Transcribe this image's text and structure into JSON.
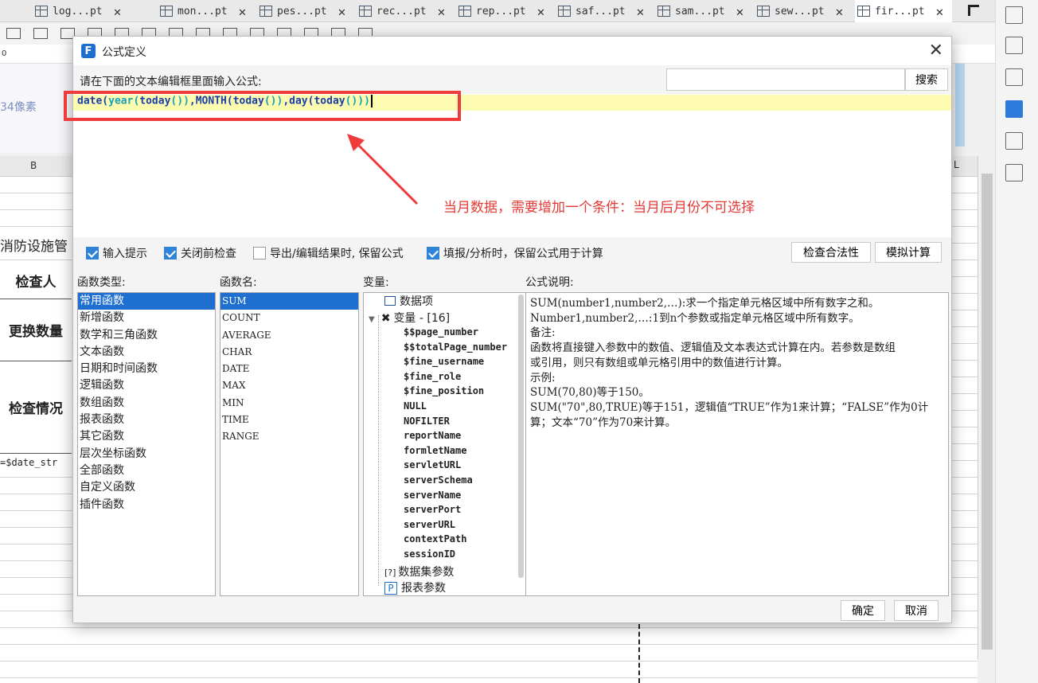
{
  "tabs": [
    {
      "label": "log...pt"
    },
    {
      "label": "mon...pt"
    },
    {
      "label": "pes...pt"
    },
    {
      "label": "rec...pt"
    },
    {
      "label": "rep...pt"
    },
    {
      "label": "saf...pt"
    },
    {
      "label": "sam...pt"
    },
    {
      "label": "sew...pt"
    },
    {
      "label": "fir...pt",
      "active": true
    }
  ],
  "ruler": {
    "zero": "0"
  },
  "left_prop": {
    "px_text": "34像素"
  },
  "sheet": {
    "col_b": "B",
    "col_l": "L",
    "b1": "消防设施管",
    "rows": [
      {
        "label": "检查人"
      },
      {
        "label": "更换数量"
      },
      {
        "label": "检查情况"
      }
    ],
    "date_cell": "=$date_str"
  },
  "dialog": {
    "title": "公式定义",
    "prompt": "请在下面的文本编辑框里面输入公式:",
    "search_button": "搜索",
    "search_value": "",
    "formula": {
      "p1": "date(",
      "p2": "year(",
      "p3": "today",
      "p4": "())",
      "p5": ",MONTH(",
      "p6": "today",
      "p7": "())",
      "p8": ",day(",
      "p9": "today",
      "p10": "()))"
    },
    "annotation": "当月数据，需要增加一个条件：当月后月份不可选择",
    "checkboxes": [
      {
        "label": "输入提示",
        "checked": true
      },
      {
        "label": "关闭前检查",
        "checked": true
      },
      {
        "label": "导出/编辑结果时, 保留公式",
        "checked": false
      },
      {
        "label": "填报/分析时，保留公式用于计算",
        "checked": true
      }
    ],
    "check_validity_button": "检查合法性",
    "simulate_button": "模拟计算",
    "headers": {
      "func_type": "函数类型:",
      "func_name": "函数名:",
      "variables": "变量:",
      "description": "公式说明:"
    },
    "func_types": [
      "常用函数",
      "新增函数",
      "数学和三角函数",
      "文本函数",
      "日期和时间函数",
      "逻辑函数",
      "数组函数",
      "报表函数",
      "其它函数",
      "层次坐标函数",
      "全部函数",
      "自定义函数",
      "插件函数"
    ],
    "func_names": [
      "SUM",
      "COUNT",
      "AVERAGE",
      "CHAR",
      "DATE",
      "MAX",
      "MIN",
      "TIME",
      "RANGE"
    ],
    "variables": {
      "data_items": "数据项",
      "vars_label": "变量 - [16]",
      "items": [
        "$$page_number",
        "$$totalPage_number",
        "$fine_username",
        "$fine_role",
        "$fine_position",
        "NULL",
        "NOFILTER",
        "reportName",
        "formletName",
        "servletURL",
        "serverSchema",
        "serverName",
        "serverPort",
        "serverURL",
        "contextPath",
        "sessionID"
      ],
      "dataset_params": "数据集参数",
      "report_params": "报表参数"
    },
    "description": {
      "lines": [
        "SUM(number1,number2,…):求一个指定单元格区域中所有数字之和。",
        "Number1,number2,…:1到n个参数或指定单元格区域中所有数字。",
        "备注:",
        "函数将直接键入参数中的数值、逻辑值及文本表达式计算在内。若参数是数组",
        "或引用，则只有数组或单元格引用中的数值进行计算。",
        "示例:",
        "SUM(70,80)等于150。",
        "SUM(\"70\",80,TRUE)等于151，逻辑值“TRUE”作为1来计算；“FALSE”作为0计",
        "算；文本“70”作为70来计算。"
      ]
    },
    "ok_button": "确定",
    "cancel_button": "取消"
  },
  "colors": {
    "accent": "#1f6fd1",
    "red": "#ef3b3b",
    "formula_fn": "#1a3fa8",
    "formula_paren": "#17a2b8",
    "formula_highlight": "#fdfbb0"
  }
}
